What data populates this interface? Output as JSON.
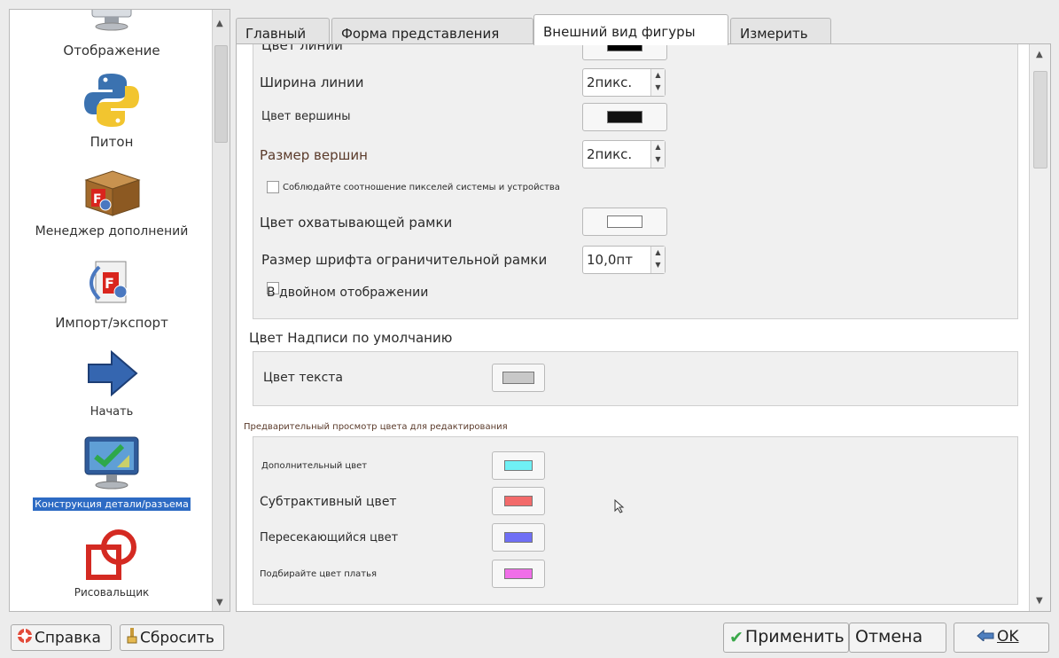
{
  "sidebar": {
    "items": [
      {
        "label": "Отображение",
        "icon": "monitor-icon"
      },
      {
        "label": "Питон",
        "icon": "python-icon"
      },
      {
        "label": "Менеджер дополнений",
        "icon": "addon-box-icon"
      },
      {
        "label": "Импорт/экспорт",
        "icon": "import-export-icon"
      },
      {
        "label": "Начать",
        "icon": "arrow-right-icon"
      },
      {
        "label": "Конструкция детали/разъема",
        "icon": "part-design-monitor-icon",
        "selected": true
      },
      {
        "label": "Рисовальщик",
        "icon": "draft-shapes-icon"
      }
    ]
  },
  "tabs": [
    {
      "label": "Главный"
    },
    {
      "label": "Форма представления"
    },
    {
      "label": "Внешний вид фигуры",
      "active": true
    },
    {
      "label": "Измерить"
    }
  ],
  "shape_appearance": {
    "line_color_label": "Цвет линии",
    "line_color": "#000000",
    "line_width_label": "Ширина линии",
    "line_width_value": "2пикс.",
    "vertex_color_label": "Цвет вершины",
    "vertex_color": "#111111",
    "vertex_size_label": "Размер вершин",
    "vertex_size_value": "2пикс.",
    "pixel_ratio_label": "Соблюдайте соотношение пикселей системы и устройства",
    "pixel_ratio_checked": false,
    "bbox_color_label": "Цвет охватывающей рамки",
    "bbox_color": "#ffffff",
    "bbox_font_label": "Размер шрифта ограничительной рамки",
    "bbox_font_value": "10,0пт",
    "dual_display_label": "В двойном отображении"
  },
  "default_annotation": {
    "title": "Цвет Надписи по умолчанию",
    "text_color_label": "Цвет текста",
    "text_color": "#c8c8c8"
  },
  "color_preview": {
    "title": "Предварительный просмотр цвета для редактирования",
    "items": [
      {
        "label": "Дополнительный цвет",
        "color": "#6ff0f5"
      },
      {
        "label": "Субтрактивный цвет",
        "color": "#f26a6a"
      },
      {
        "label": "Пересекающийся цвет",
        "color": "#6f6ff5"
      },
      {
        "label": "Подбирайте цвет платья",
        "color": "#f06ee8"
      }
    ]
  },
  "buttons": {
    "help": "Справка",
    "reset": "Сбросить",
    "apply": "Применить",
    "cancel": "Отмена",
    "ok": "OK"
  },
  "colors": {
    "selection": "#2d6bc4"
  }
}
